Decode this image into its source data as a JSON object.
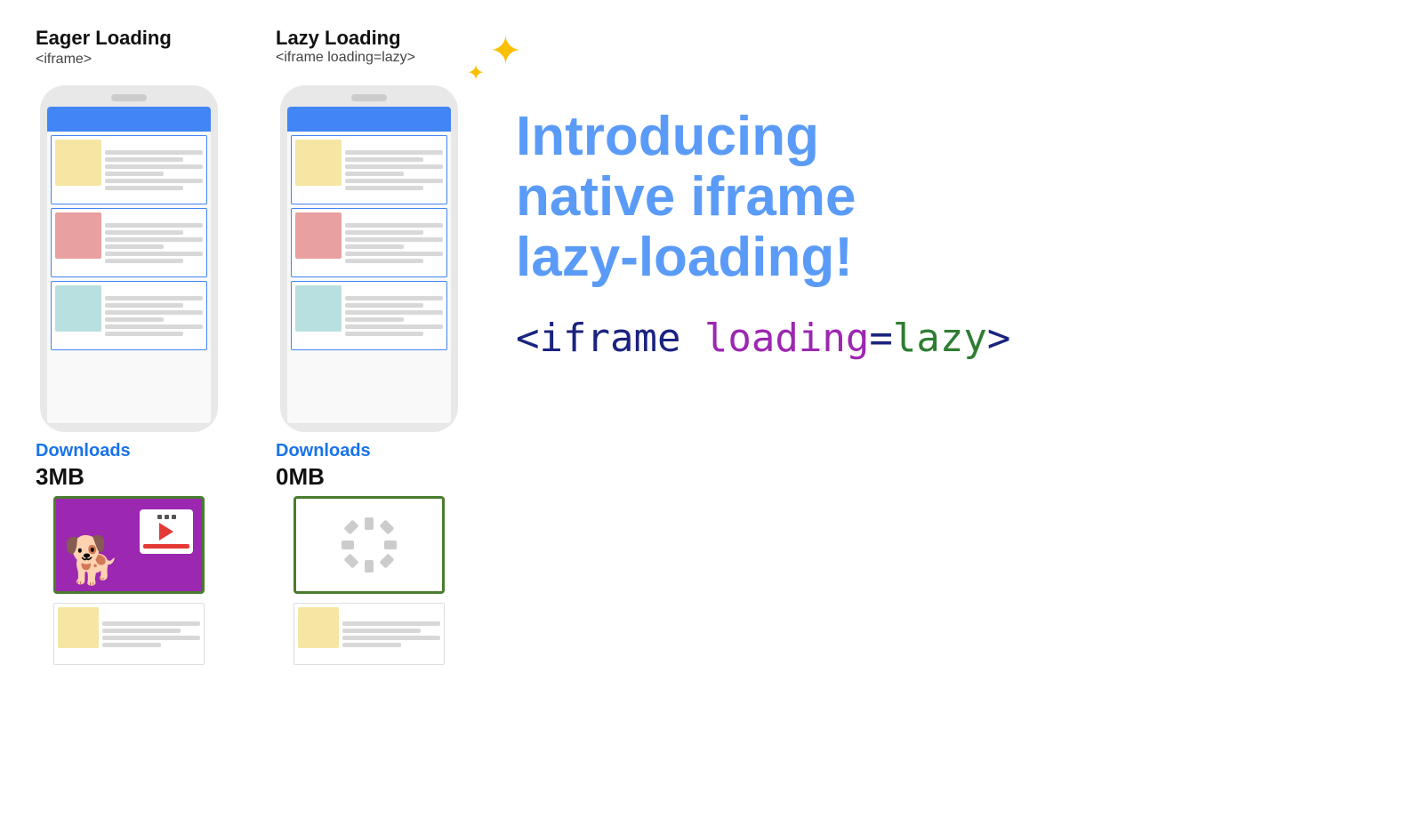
{
  "eager": {
    "title": "Eager Loading",
    "code": "<iframe>",
    "downloads_label": "Downloads",
    "downloads_size": "3MB"
  },
  "lazy": {
    "title": "Lazy Loading",
    "code": "<iframe loading=lazy>",
    "downloads_label": "Downloads",
    "downloads_size": "0MB"
  },
  "intro": {
    "line1": "Introducing",
    "line2": "native iframe",
    "line3": "lazy-loading!"
  },
  "code_example": {
    "part1": "<iframe ",
    "part2": "loading",
    "part3": "=",
    "part4": "lazy",
    "part5": ">"
  },
  "sparkle_label": "✦"
}
